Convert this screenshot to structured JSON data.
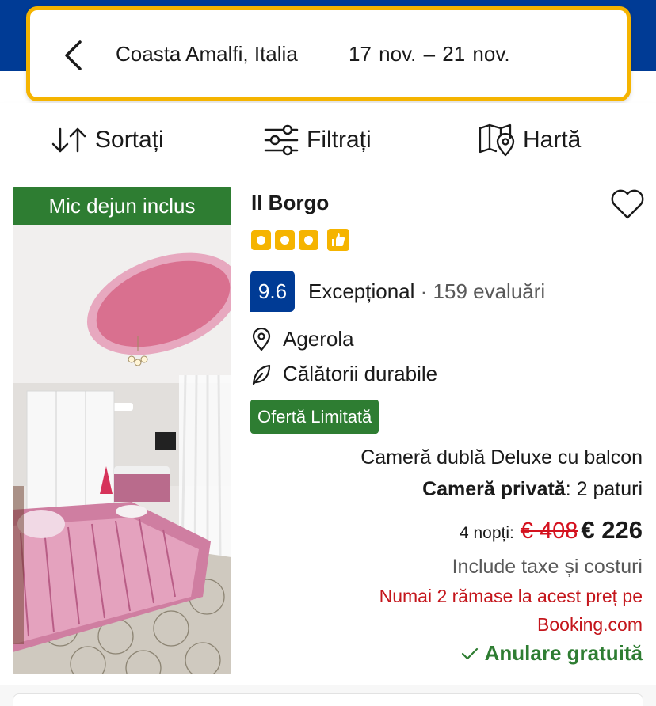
{
  "search": {
    "destination": "Coasta Amalfi, Italia",
    "dates": "17 nov.  –  21 nov."
  },
  "toolbar": {
    "sort_label": "Sortați",
    "filter_label": "Filtrați",
    "map_label": "Hartă"
  },
  "listing": {
    "breakfast_badge": "Mic dejun inclus",
    "name": "Il Borgo",
    "stars": 3,
    "score": "9.6",
    "score_word": "Excepțional",
    "score_separator": " · ",
    "reviews": "159 evaluări",
    "location": "Agerola",
    "sustainability": "Călătorii durabile",
    "offer_badge": "Ofertă Limitată",
    "room_type": "Cameră dublă Deluxe cu balcon",
    "room_kind": "Cameră privată",
    "room_beds": ": 2 paturi",
    "nights": "4 nopți:",
    "old_price": "€ 408",
    "new_price": "€ 226",
    "taxes": "Include taxe și costuri",
    "scarcity_line1": "Numai 2 rămase la acest preț pe",
    "scarcity_line2": "Booking.com",
    "cancellation": "Anulare gratuită"
  },
  "colors": {
    "brand_blue": "#003b95",
    "accent_yellow": "#f5b400",
    "green": "#2e7d32",
    "red": "#c4161c"
  }
}
